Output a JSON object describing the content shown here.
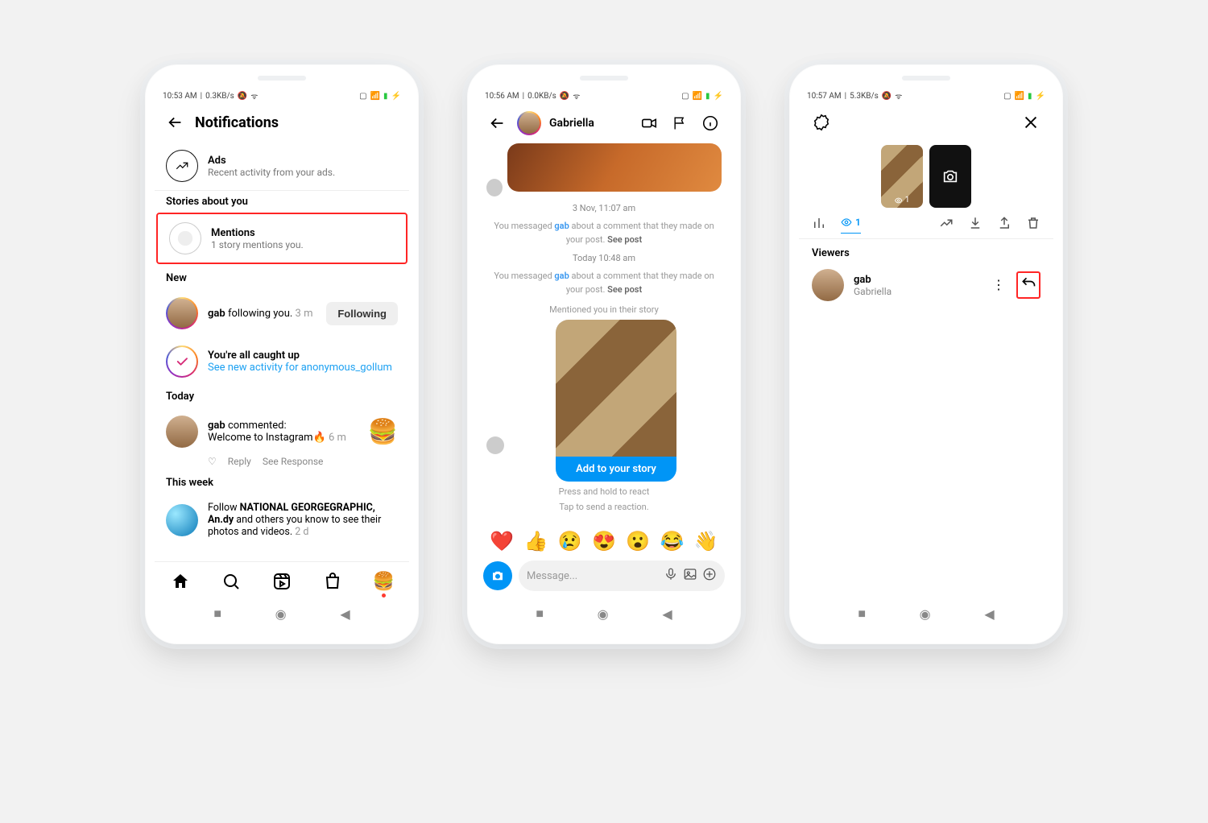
{
  "phone1": {
    "status": {
      "time": "10:53 AM",
      "net": "0.3KB/s"
    },
    "header": {
      "title": "Notifications"
    },
    "ads": {
      "title": "Ads",
      "subtitle": "Recent activity from your ads."
    },
    "stories_section": "Stories about you",
    "mentions": {
      "title": "Mentions",
      "subtitle": "1 story mentions you."
    },
    "new_section": "New",
    "follower": {
      "username": "gab",
      "action": "following you.",
      "time": "3 m",
      "button": "Following"
    },
    "caught_up": {
      "text": "You're all caught up",
      "link": "See new activity for anonymous_gollum"
    },
    "today_section": "Today",
    "comment": {
      "username": "gab",
      "action": "commented:",
      "body": "Welcome to Instagram🔥",
      "time": "6 m",
      "reply": "Reply",
      "see_response": "See Response"
    },
    "this_week_section": "This week",
    "suggestion": {
      "prefix": "Follow ",
      "names": "NATIONAL GEORGEGRAPHIC, An.dy",
      "suffix": " and others you know to see their photos and videos.",
      "time": "2 d"
    }
  },
  "phone2": {
    "status": {
      "time": "10:56 AM",
      "net": "0.0KB/s"
    },
    "header": {
      "name": "Gabriella"
    },
    "ts1": "3 Nov, 11:07 am",
    "msg1": {
      "pre": "You messaged ",
      "name": "gab",
      "post": " about a comment that they made on your post.",
      "see": "See post"
    },
    "ts2": "Today 10:48 am",
    "msg2": {
      "pre": "You messaged ",
      "name": "gab",
      "post": " about a comment that they made on your post.",
      "see": "See post"
    },
    "mention_label": "Mentioned you in their story",
    "story_button": "Add to your story",
    "react_hint": "Press and hold to react",
    "send_hint": "Tap to send a reaction.",
    "emojis": [
      "❤️",
      "👍",
      "😢",
      "😍",
      "😮",
      "😂",
      "👋"
    ],
    "composer_placeholder": "Message..."
  },
  "phone3": {
    "status": {
      "time": "10:57 AM",
      "net": "5.3KB/s"
    },
    "thumb_count": "1",
    "toolbar_tab": "1",
    "viewers_label": "Viewers",
    "viewer": {
      "username": "gab",
      "fullname": "Gabriella"
    }
  }
}
